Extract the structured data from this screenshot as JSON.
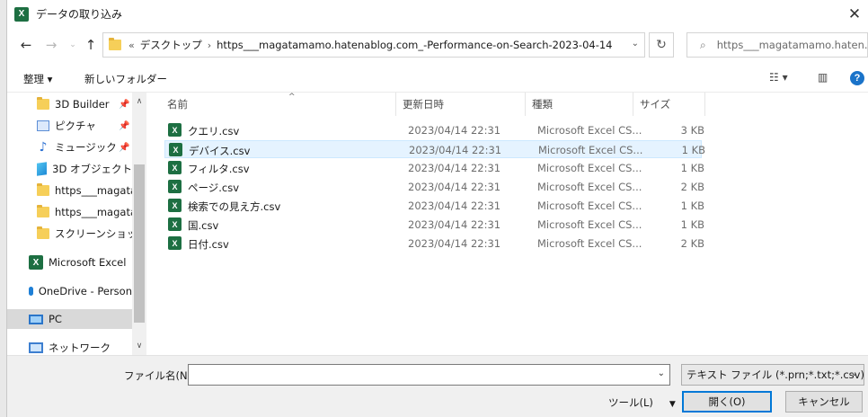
{
  "window": {
    "title": "データの取り込み",
    "close": "✕",
    "app_icon": "X"
  },
  "nav": {
    "back": "←",
    "forward": "→",
    "up": "↑",
    "breadcrumb_prefix": "«",
    "crumbs": [
      "デスクトップ",
      "https___magatamamo.hatenablog.com_-Performance-on-Search-2023-04-14"
    ],
    "search_placeholder": "https___magatamamo.haten..."
  },
  "toolbar": {
    "organize": "整理 ▾",
    "new_folder": "新しいフォルダー"
  },
  "sidebar": {
    "items": [
      {
        "label": "3D Builder",
        "icon": "folder-icon",
        "pinned": true
      },
      {
        "label": "ピクチャ",
        "icon": "pictures-icon",
        "pinned": true
      },
      {
        "label": "ミュージック",
        "icon": "music-icon",
        "pinned": true
      },
      {
        "label": "3D オブジェクト",
        "icon": "3d-objects-icon"
      },
      {
        "label": "https___magatam",
        "icon": "folder-icon"
      },
      {
        "label": "https___magatam",
        "icon": "folder-icon"
      },
      {
        "label": "スクリーンショット",
        "icon": "folder-icon"
      },
      {
        "label": "Microsoft Excel",
        "icon": "excel-icon"
      },
      {
        "label": "OneDrive - Person",
        "icon": "onedrive-icon"
      },
      {
        "label": "PC",
        "icon": "pc-icon",
        "selected": true
      },
      {
        "label": "ネットワーク",
        "icon": "network-icon"
      }
    ]
  },
  "columns": {
    "name": "名前",
    "date": "更新日時",
    "type": "種類",
    "size": "サイズ"
  },
  "files": [
    {
      "name": "クエリ.csv",
      "date": "2023/04/14 22:31",
      "type": "Microsoft Excel CS...",
      "size": "3 KB"
    },
    {
      "name": "デバイス.csv",
      "date": "2023/04/14 22:31",
      "type": "Microsoft Excel CS...",
      "size": "1 KB",
      "selected": true
    },
    {
      "name": "フィルタ.csv",
      "date": "2023/04/14 22:31",
      "type": "Microsoft Excel CS...",
      "size": "1 KB"
    },
    {
      "name": "ページ.csv",
      "date": "2023/04/14 22:31",
      "type": "Microsoft Excel CS...",
      "size": "2 KB"
    },
    {
      "name": "検索での見え方.csv",
      "date": "2023/04/14 22:31",
      "type": "Microsoft Excel CS...",
      "size": "1 KB"
    },
    {
      "name": "国.csv",
      "date": "2023/04/14 22:31",
      "type": "Microsoft Excel CS...",
      "size": "1 KB"
    },
    {
      "name": "日付.csv",
      "date": "2023/04/14 22:31",
      "type": "Microsoft Excel CS...",
      "size": "2 KB"
    }
  ],
  "footer": {
    "filename_label": "ファイル名(N):",
    "filename_value": "",
    "file_type": "テキスト ファイル (*.prn;*.txt;*.csv)",
    "tools": "ツール(L)",
    "open": "開く(O)",
    "cancel": "キャンセル"
  },
  "colors": {
    "accent": "#0078d7",
    "excel": "#1d6f42",
    "selection": "#e5f3ff"
  }
}
